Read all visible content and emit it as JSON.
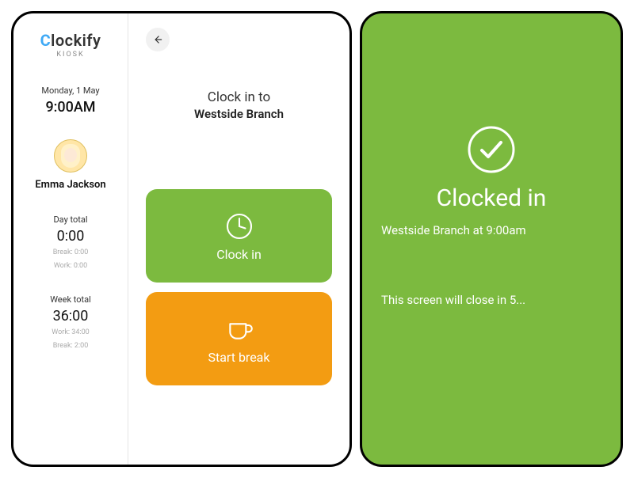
{
  "brand": {
    "name": "Clockify",
    "sub": "KIOSK"
  },
  "sidebar": {
    "date": "Monday, 1 May",
    "time": "9:00AM",
    "user": "Emma Jackson",
    "day": {
      "label": "Day total",
      "value": "0:00",
      "break": "Break: 0:00",
      "work": "Work: 0:00"
    },
    "week": {
      "label": "Week total",
      "value": "36:00",
      "work": "Work: 34:00",
      "break": "Break: 2:00"
    }
  },
  "main": {
    "title": "Clock in to",
    "location": "Westside Branch",
    "clockin_btn": "Clock in",
    "break_btn": "Start break"
  },
  "confirm": {
    "title": "Clocked in",
    "sub": "Westside Branch at 9:00am",
    "closing": "This screen will close in 5..."
  },
  "colors": {
    "green": "#7CBA3F",
    "orange": "#F39C12",
    "brand_blue": "#3FA9F5"
  }
}
